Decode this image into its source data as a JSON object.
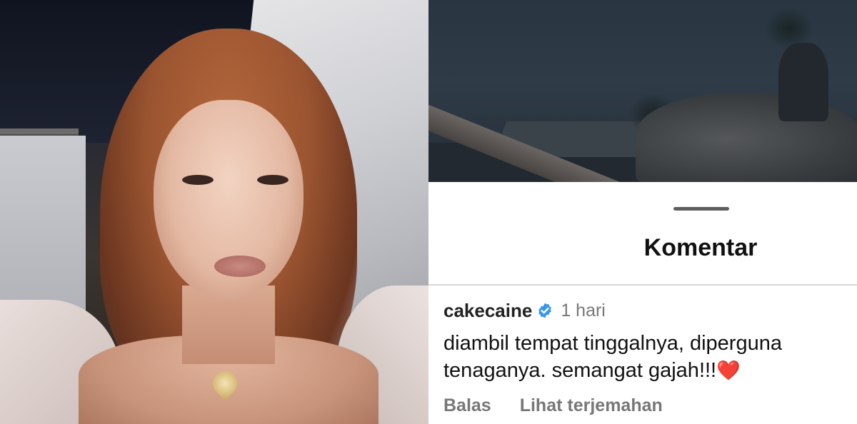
{
  "sheet": {
    "title": "Komentar"
  },
  "comment": {
    "username": "cakecaine",
    "verified_icon": "verified-badge-icon",
    "timestamp": "1 hari",
    "text_line1": "diambil tempat tinggalnya, diperguna",
    "text_line2": "tenaganya. semangat gajah!!!",
    "emoji": "❤️",
    "reply_label": "Balas",
    "translate_label": "Lihat terjemahan"
  },
  "colors": {
    "verified_blue": "#3797f0",
    "heart_red": "#e0245e",
    "muted_text": "#777777",
    "primary_text": "#111111"
  }
}
